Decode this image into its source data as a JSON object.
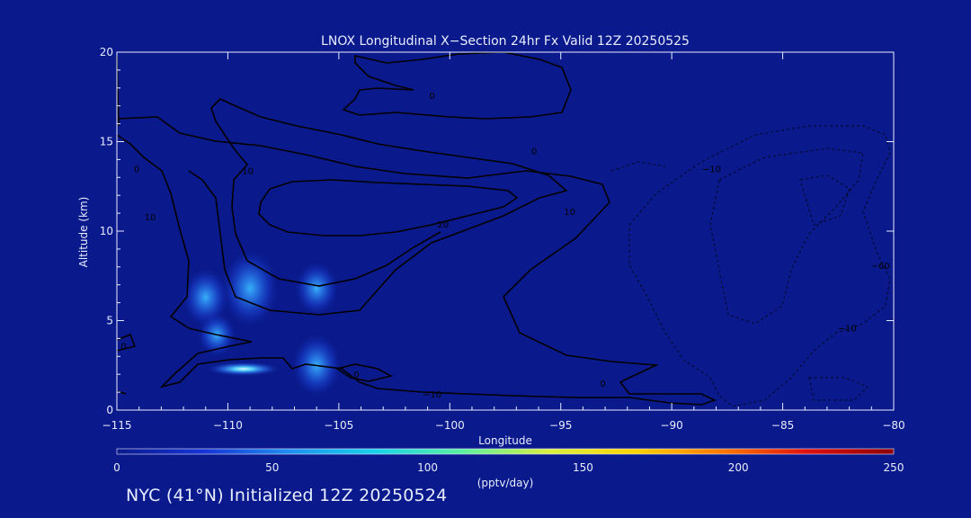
{
  "chart_data": {
    "type": "heatmap",
    "title": "LNOX Longitudinal X−Section 24hr  Fx Valid 12Z 20250525",
    "xlabel": "Longitude",
    "ylabel": "Altitude (km)",
    "xlim": [
      -115,
      -80
    ],
    "ylim": [
      0,
      20
    ],
    "x_ticks": [
      -115,
      -110,
      -105,
      -100,
      -95,
      -90,
      -85,
      -80
    ],
    "x_tick_labels": [
      "−115",
      "−110",
      "−105",
      "−100",
      "−95",
      "−90",
      "−85",
      "−80"
    ],
    "y_ticks": [
      0,
      5,
      10,
      15,
      20
    ],
    "y_tick_labels": [
      "0",
      "5",
      "10",
      "15",
      "20"
    ],
    "colorbar": {
      "label": "(pptv/day)",
      "min": 0,
      "max": 250,
      "ticks": [
        0,
        50,
        100,
        150,
        200,
        250
      ],
      "colors": [
        "#0a1a8c",
        "#1733d6",
        "#1f8ff0",
        "#18d3ea",
        "#5cf0a0",
        "#d8f040",
        "#ffd400",
        "#ff7a00",
        "#e01010",
        "#8c0000"
      ]
    },
    "hotspots": [
      {
        "lon": -109,
        "alt": 6.8,
        "value": 55
      },
      {
        "lon": -111,
        "alt": 6.3,
        "value": 35
      },
      {
        "lon": -106,
        "alt": 6.8,
        "value": 30
      },
      {
        "lon": -109.3,
        "alt": 2.3,
        "value": 85
      },
      {
        "lon": -106,
        "alt": 2.5,
        "value": 40
      },
      {
        "lon": -110.5,
        "alt": 4.2,
        "value": 20
      }
    ],
    "contour_labels": [
      {
        "text": "0",
        "lon": -114.1,
        "alt": 13.5
      },
      {
        "text": "10",
        "lon": -109.1,
        "alt": 13.4
      },
      {
        "text": "0",
        "lon": -100.8,
        "alt": 17.6
      },
      {
        "text": "0",
        "lon": -96.2,
        "alt": 14.5
      },
      {
        "text": "10",
        "lon": -94.6,
        "alt": 11.1
      },
      {
        "text": "20",
        "lon": -100.3,
        "alt": 10.4
      },
      {
        "text": "10",
        "lon": -113.5,
        "alt": 10.8
      },
      {
        "text": "0",
        "lon": -114.7,
        "alt": 3.6
      },
      {
        "text": "0",
        "lon": -93.1,
        "alt": 1.5
      },
      {
        "text": "0",
        "lon": -104.2,
        "alt": 2.0
      },
      {
        "text": "−10",
        "lon": -100.8,
        "alt": 0.9
      },
      {
        "text": "−10",
        "lon": -88.2,
        "alt": 13.5
      },
      {
        "text": "−60",
        "lon": -80.6,
        "alt": 8.1
      },
      {
        "text": "−10",
        "lon": -82.1,
        "alt": 4.6
      }
    ],
    "grid": false,
    "legend": "none"
  },
  "footer": {
    "text": "NYC (41°N) Initialized 12Z 20250524"
  }
}
